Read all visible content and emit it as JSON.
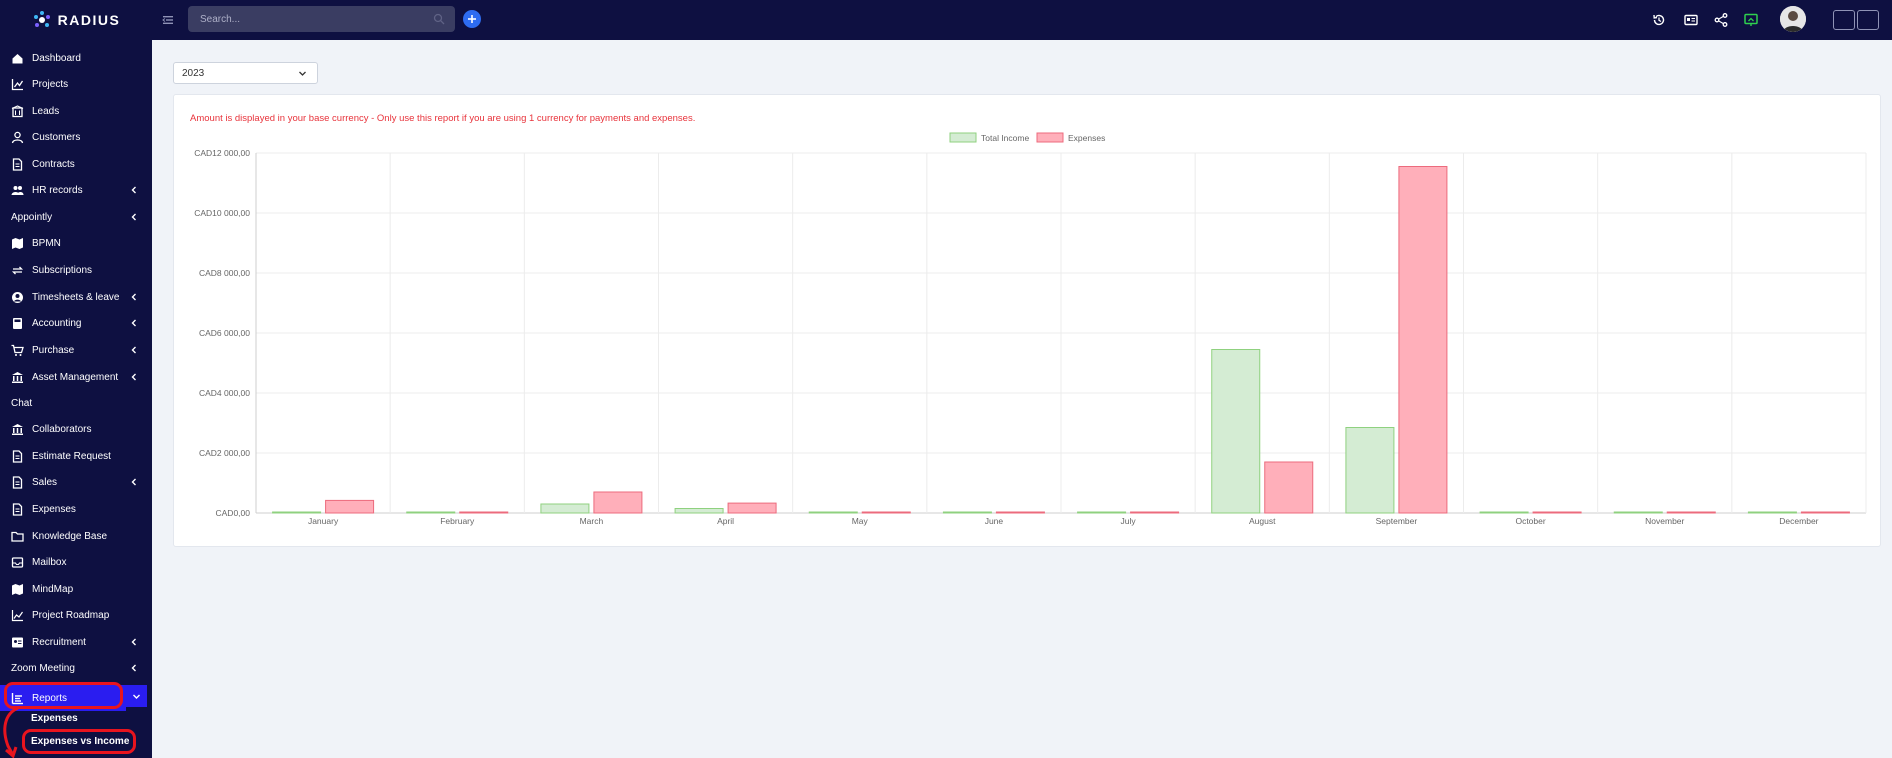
{
  "brand": {
    "name": "RADIUS"
  },
  "search": {
    "placeholder": "Search..."
  },
  "sidebar": {
    "items": [
      {
        "label": "Dashboard",
        "icon": "home-icon",
        "chevron": false,
        "plain": false
      },
      {
        "label": "Projects",
        "icon": "chart-icon",
        "chevron": false,
        "plain": false
      },
      {
        "label": "Leads",
        "icon": "building-icon",
        "chevron": false,
        "plain": false
      },
      {
        "label": "Customers",
        "icon": "user-icon",
        "chevron": false,
        "plain": false
      },
      {
        "label": "Contracts",
        "icon": "document-icon",
        "chevron": false,
        "plain": false
      },
      {
        "label": "HR records",
        "icon": "users-icon",
        "chevron": true,
        "plain": false
      },
      {
        "label": "Appointly",
        "icon": "",
        "chevron": true,
        "plain": true
      },
      {
        "label": "BPMN",
        "icon": "map-icon",
        "chevron": false,
        "plain": false
      },
      {
        "label": "Subscriptions",
        "icon": "repeat-icon",
        "chevron": false,
        "plain": false
      },
      {
        "label": "Timesheets & leave",
        "icon": "user-circle-icon",
        "chevron": true,
        "plain": false
      },
      {
        "label": "Accounting",
        "icon": "calculator-icon",
        "chevron": true,
        "plain": false
      },
      {
        "label": "Purchase",
        "icon": "cart-icon",
        "chevron": true,
        "plain": false
      },
      {
        "label": "Asset Management",
        "icon": "bank-icon",
        "chevron": true,
        "plain": false
      },
      {
        "label": "Chat",
        "icon": "",
        "chevron": false,
        "plain": true
      },
      {
        "label": "Collaborators",
        "icon": "bank-icon",
        "chevron": false,
        "plain": false
      },
      {
        "label": "Estimate Request",
        "icon": "document-icon",
        "chevron": false,
        "plain": false
      },
      {
        "label": "Sales",
        "icon": "document-icon",
        "chevron": true,
        "plain": false
      },
      {
        "label": "Expenses",
        "icon": "document-icon",
        "chevron": false,
        "plain": false
      },
      {
        "label": "Knowledge Base",
        "icon": "folder-icon",
        "chevron": false,
        "plain": false
      },
      {
        "label": "Mailbox",
        "icon": "inbox-icon",
        "chevron": false,
        "plain": false
      },
      {
        "label": "MindMap",
        "icon": "map-icon",
        "chevron": false,
        "plain": false
      },
      {
        "label": "Project Roadmap",
        "icon": "line-chart-icon",
        "chevron": false,
        "plain": false
      },
      {
        "label": "Recruitment",
        "icon": "id-card-icon",
        "chevron": true,
        "plain": false
      },
      {
        "label": "Zoom Meeting",
        "icon": "",
        "chevron": true,
        "plain": true
      }
    ],
    "reports": {
      "label": "Reports",
      "icon": "bar-chart-icon"
    },
    "sub_items": [
      "Expenses",
      "Expenses vs Income"
    ]
  },
  "main": {
    "year": "2023",
    "notice": "Amount is displayed in your base currency - Only use this report if you are using 1 currency for payments and expenses."
  },
  "colors": {
    "income_fill": "#d4ecd3",
    "income_stroke": "#8fd17f",
    "expense_fill": "#ffafba",
    "expense_stroke": "#ec6b7d",
    "notice": "#e8333b",
    "highlight": "#e8141e"
  },
  "chart_data": {
    "type": "bar",
    "title": "",
    "legend_position": "top-center",
    "grid": true,
    "categories": [
      "January",
      "February",
      "March",
      "April",
      "May",
      "June",
      "July",
      "August",
      "September",
      "October",
      "November",
      "December"
    ],
    "series": [
      {
        "name": "Total Income",
        "values": [
          0,
          0,
          300,
          150,
          0,
          0,
          0,
          5450,
          2850,
          0,
          0,
          0
        ]
      },
      {
        "name": "Expenses",
        "values": [
          420,
          0,
          700,
          330,
          0,
          0,
          0,
          1700,
          11550,
          0,
          0,
          0
        ]
      }
    ],
    "ylim": [
      0,
      12000
    ],
    "ytick_labels": [
      "CAD0,00",
      "CAD2 000,00",
      "CAD4 000,00",
      "CAD6 000,00",
      "CAD8 000,00",
      "CAD10 000,00",
      "CAD12 000,00"
    ],
    "xlabel": "",
    "ylabel": ""
  }
}
